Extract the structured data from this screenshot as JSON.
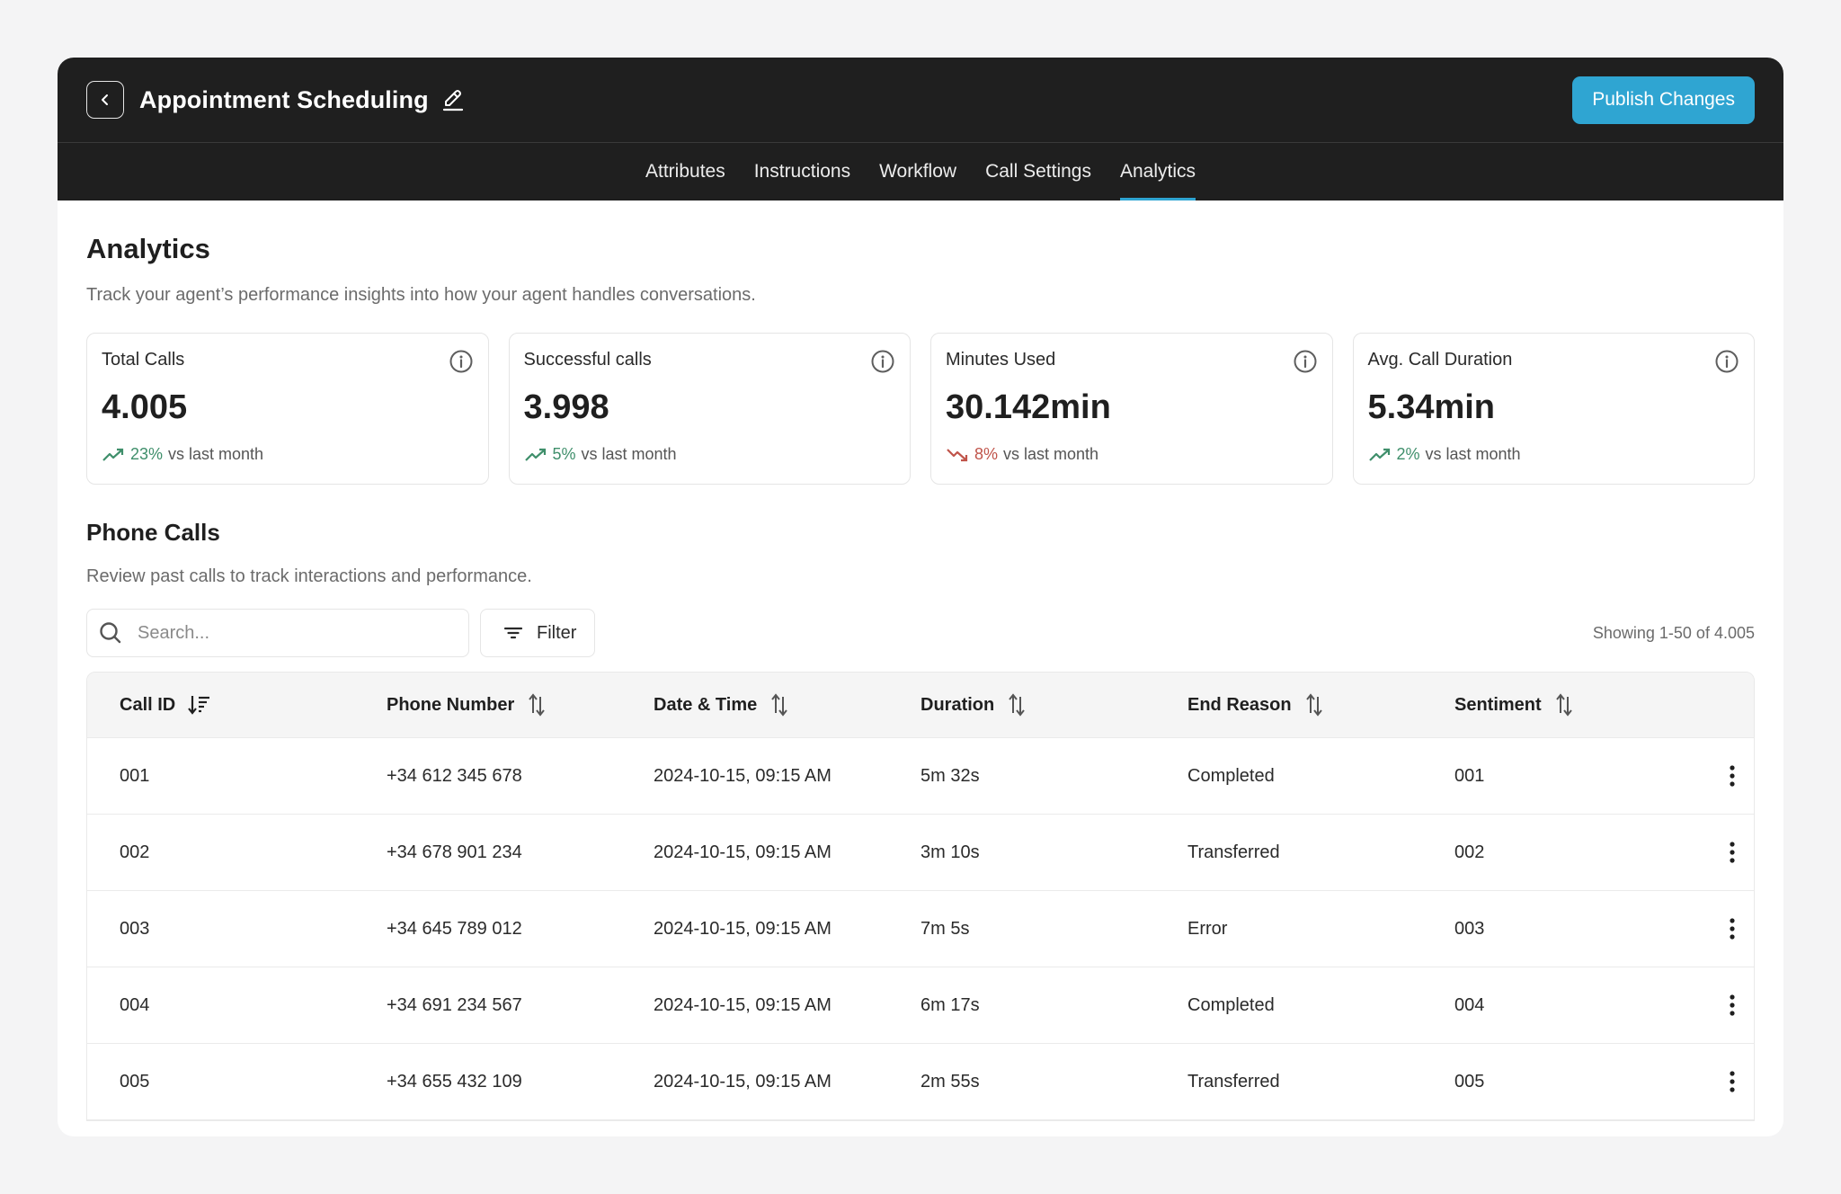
{
  "header": {
    "title": "Appointment Scheduling",
    "publish_label": "Publish Changes",
    "back_icon": "chevron-left-icon",
    "edit_icon": "pencil-icon"
  },
  "tabs": [
    {
      "label": "Attributes",
      "active": false
    },
    {
      "label": "Instructions",
      "active": false
    },
    {
      "label": "Workflow",
      "active": false
    },
    {
      "label": "Call Settings",
      "active": false
    },
    {
      "label": "Analytics",
      "active": true
    }
  ],
  "analytics": {
    "title": "Analytics",
    "subtitle": "Track your agent’s performance insights into how your agent handles conversations."
  },
  "stats": [
    {
      "label": "Total Calls",
      "value": "4.005",
      "change": "23%",
      "direction": "up",
      "suffix": "vs last month"
    },
    {
      "label": "Successful calls",
      "value": "3.998",
      "change": "5%",
      "direction": "up",
      "suffix": "vs last month"
    },
    {
      "label": "Minutes Used",
      "value": "30.142min",
      "change": "8%",
      "direction": "down",
      "suffix": "vs last month"
    },
    {
      "label": "Avg. Call Duration",
      "value": "5.34min",
      "change": "2%",
      "direction": "up",
      "suffix": "vs last month"
    }
  ],
  "phone_calls": {
    "title": "Phone Calls",
    "subtitle": "Review past calls to track interactions and performance.",
    "search_placeholder": "Search...",
    "search_value": "",
    "filter_label": "Filter",
    "showing": "Showing 1-50 of 4.005",
    "columns": [
      {
        "label": "Call ID",
        "sort": "sorted-desc"
      },
      {
        "label": "Phone Number",
        "sort": "sortable"
      },
      {
        "label": "Date & Time",
        "sort": "sortable"
      },
      {
        "label": "Duration",
        "sort": "sortable"
      },
      {
        "label": "End Reason",
        "sort": "sortable"
      },
      {
        "label": "Sentiment",
        "sort": "sortable"
      }
    ],
    "rows": [
      [
        "001",
        "+34 612 345 678",
        "2024-10-15, 09:15 AM",
        "5m 32s",
        "Completed",
        "001"
      ],
      [
        "002",
        "+34 678 901 234",
        "2024-10-15, 09:15 AM",
        "3m 10s",
        "Transferred",
        "002"
      ],
      [
        "003",
        "+34 645 789 012",
        "2024-10-15, 09:15 AM",
        "7m 5s",
        "Error",
        "003"
      ],
      [
        "004",
        "+34 691 234 567",
        "2024-10-15, 09:15 AM",
        "6m 17s",
        "Completed",
        "004"
      ],
      [
        "005",
        "+34 655 432 109",
        "2024-10-15, 09:15 AM",
        "2m 55s",
        "Transferred",
        "005"
      ]
    ]
  },
  "colors": {
    "accent": "#2fa5d2",
    "header_bg": "#1f1f1f",
    "trend_up": "#3f8f6b",
    "trend_down": "#c0544a"
  }
}
